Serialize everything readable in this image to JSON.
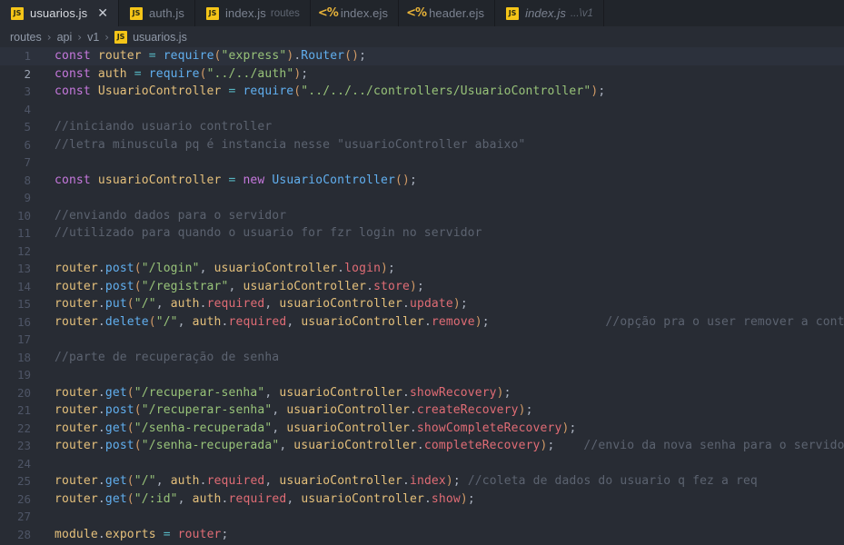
{
  "window": {
    "active_file": "usuarios.js",
    "theme_background": "#282c34",
    "accent": "#61afef"
  },
  "tabs": [
    {
      "label": "usuarios.js",
      "desc": "",
      "icon": "js-file-icon",
      "active": true,
      "preview": false,
      "closable": true
    },
    {
      "label": "auth.js",
      "desc": "",
      "icon": "js-file-icon",
      "active": false,
      "preview": false,
      "closable": false
    },
    {
      "label": "index.js",
      "desc": "routes",
      "icon": "js-file-icon",
      "active": false,
      "preview": false,
      "closable": false
    },
    {
      "label": "index.ejs",
      "desc": "",
      "icon": "ejs-file-icon",
      "active": false,
      "preview": false,
      "closable": false
    },
    {
      "label": "header.ejs",
      "desc": "",
      "icon": "ejs-file-icon",
      "active": false,
      "preview": false,
      "closable": false
    },
    {
      "label": "index.js",
      "desc": "...\\v1",
      "icon": "js-file-icon",
      "active": false,
      "preview": true,
      "closable": false
    }
  ],
  "tab_close_glyph": "✕",
  "breadcrumb": {
    "separator": "›",
    "items": [
      "routes",
      "api",
      "v1"
    ],
    "file": "usuarios.js",
    "file_icon": "js-file-icon"
  },
  "editor": {
    "language": "javascript",
    "first_line": 1,
    "cursor_line": 2,
    "highlighted_lines": [
      1
    ],
    "lines": [
      {
        "n": 1,
        "tokens": [
          {
            "t": "const",
            "c": "kw"
          },
          {
            "t": " "
          },
          {
            "t": "router",
            "c": "var"
          },
          {
            "t": " "
          },
          {
            "t": "=",
            "c": "op"
          },
          {
            "t": " "
          },
          {
            "t": "require",
            "c": "fn"
          },
          {
            "t": "(",
            "c": "par"
          },
          {
            "t": "\"express\"",
            "c": "str"
          },
          {
            "t": ")",
            "c": "par"
          },
          {
            "t": ".",
            "c": "pun"
          },
          {
            "t": "Router",
            "c": "fn"
          },
          {
            "t": "(",
            "c": "par"
          },
          {
            "t": ")",
            "c": "par"
          },
          {
            "t": ";",
            "c": "pun"
          }
        ]
      },
      {
        "n": 2,
        "tokens": [
          {
            "t": "const",
            "c": "kw"
          },
          {
            "t": " "
          },
          {
            "t": "auth",
            "c": "var"
          },
          {
            "t": " "
          },
          {
            "t": "=",
            "c": "op"
          },
          {
            "t": " "
          },
          {
            "t": "require",
            "c": "fn"
          },
          {
            "t": "(",
            "c": "par"
          },
          {
            "t": "\"../../auth\"",
            "c": "str"
          },
          {
            "t": ")",
            "c": "par"
          },
          {
            "t": ";",
            "c": "pun"
          }
        ]
      },
      {
        "n": 3,
        "tokens": [
          {
            "t": "const",
            "c": "kw"
          },
          {
            "t": " "
          },
          {
            "t": "UsuarioController",
            "c": "var"
          },
          {
            "t": " "
          },
          {
            "t": "=",
            "c": "op"
          },
          {
            "t": " "
          },
          {
            "t": "require",
            "c": "fn"
          },
          {
            "t": "(",
            "c": "par"
          },
          {
            "t": "\"../../../controllers/UsuarioController\"",
            "c": "str"
          },
          {
            "t": ")",
            "c": "par"
          },
          {
            "t": ";",
            "c": "pun"
          }
        ]
      },
      {
        "n": 4,
        "tokens": []
      },
      {
        "n": 5,
        "tokens": [
          {
            "t": "//iniciando usuario controller",
            "c": "cmt"
          }
        ]
      },
      {
        "n": 6,
        "tokens": [
          {
            "t": "//letra minuscula pq é instancia nesse \"usuarioController abaixo\"",
            "c": "cmt"
          }
        ]
      },
      {
        "n": 7,
        "tokens": []
      },
      {
        "n": 8,
        "tokens": [
          {
            "t": "const",
            "c": "kw"
          },
          {
            "t": " "
          },
          {
            "t": "usuarioController",
            "c": "var"
          },
          {
            "t": " "
          },
          {
            "t": "=",
            "c": "op"
          },
          {
            "t": " "
          },
          {
            "t": "new",
            "c": "kw"
          },
          {
            "t": " "
          },
          {
            "t": "UsuarioController",
            "c": "fn"
          },
          {
            "t": "(",
            "c": "par"
          },
          {
            "t": ")",
            "c": "par"
          },
          {
            "t": ";",
            "c": "pun"
          }
        ]
      },
      {
        "n": 9,
        "tokens": []
      },
      {
        "n": 10,
        "tokens": [
          {
            "t": "//enviando dados para o servidor",
            "c": "cmt"
          }
        ]
      },
      {
        "n": 11,
        "tokens": [
          {
            "t": "//utilizado para quando o usuario for fzr login no servidor",
            "c": "cmt"
          }
        ]
      },
      {
        "n": 12,
        "tokens": []
      },
      {
        "n": 13,
        "tokens": [
          {
            "t": "router",
            "c": "var"
          },
          {
            "t": ".",
            "c": "pun"
          },
          {
            "t": "post",
            "c": "fn"
          },
          {
            "t": "(",
            "c": "par"
          },
          {
            "t": "\"/login\"",
            "c": "str"
          },
          {
            "t": ", ",
            "c": "pun"
          },
          {
            "t": "usuarioController",
            "c": "var"
          },
          {
            "t": ".",
            "c": "pun"
          },
          {
            "t": "login",
            "c": "prop"
          },
          {
            "t": ")",
            "c": "par"
          },
          {
            "t": ";",
            "c": "pun"
          }
        ]
      },
      {
        "n": 14,
        "tokens": [
          {
            "t": "router",
            "c": "var"
          },
          {
            "t": ".",
            "c": "pun"
          },
          {
            "t": "post",
            "c": "fn"
          },
          {
            "t": "(",
            "c": "par"
          },
          {
            "t": "\"/registrar\"",
            "c": "str"
          },
          {
            "t": ", ",
            "c": "pun"
          },
          {
            "t": "usuarioController",
            "c": "var"
          },
          {
            "t": ".",
            "c": "pun"
          },
          {
            "t": "store",
            "c": "prop"
          },
          {
            "t": ")",
            "c": "par"
          },
          {
            "t": ";",
            "c": "pun"
          }
        ]
      },
      {
        "n": 15,
        "tokens": [
          {
            "t": "router",
            "c": "var"
          },
          {
            "t": ".",
            "c": "pun"
          },
          {
            "t": "put",
            "c": "fn"
          },
          {
            "t": "(",
            "c": "par"
          },
          {
            "t": "\"/\"",
            "c": "str"
          },
          {
            "t": ", ",
            "c": "pun"
          },
          {
            "t": "auth",
            "c": "var"
          },
          {
            "t": ".",
            "c": "pun"
          },
          {
            "t": "required",
            "c": "prop"
          },
          {
            "t": ", ",
            "c": "pun"
          },
          {
            "t": "usuarioController",
            "c": "var"
          },
          {
            "t": ".",
            "c": "pun"
          },
          {
            "t": "update",
            "c": "prop"
          },
          {
            "t": ")",
            "c": "par"
          },
          {
            "t": ";",
            "c": "pun"
          }
        ]
      },
      {
        "n": 16,
        "tokens": [
          {
            "t": "router",
            "c": "var"
          },
          {
            "t": ".",
            "c": "pun"
          },
          {
            "t": "delete",
            "c": "fn"
          },
          {
            "t": "(",
            "c": "par"
          },
          {
            "t": "\"/\"",
            "c": "str"
          },
          {
            "t": ", ",
            "c": "pun"
          },
          {
            "t": "auth",
            "c": "var"
          },
          {
            "t": ".",
            "c": "pun"
          },
          {
            "t": "required",
            "c": "prop"
          },
          {
            "t": ", ",
            "c": "pun"
          },
          {
            "t": "usuarioController",
            "c": "var"
          },
          {
            "t": ".",
            "c": "pun"
          },
          {
            "t": "remove",
            "c": "prop"
          },
          {
            "t": ")",
            "c": "par"
          },
          {
            "t": ";",
            "c": "pun"
          },
          {
            "t": "                ",
            "c": "pun"
          },
          {
            "t": "//opção pra o user remover a conta",
            "c": "cmt"
          }
        ]
      },
      {
        "n": 17,
        "tokens": []
      },
      {
        "n": 18,
        "tokens": [
          {
            "t": "//parte de recuperação de senha",
            "c": "cmt"
          }
        ]
      },
      {
        "n": 19,
        "tokens": []
      },
      {
        "n": 20,
        "tokens": [
          {
            "t": "router",
            "c": "var"
          },
          {
            "t": ".",
            "c": "pun"
          },
          {
            "t": "get",
            "c": "fn"
          },
          {
            "t": "(",
            "c": "par"
          },
          {
            "t": "\"/recuperar-senha\"",
            "c": "str"
          },
          {
            "t": ", ",
            "c": "pun"
          },
          {
            "t": "usuarioController",
            "c": "var"
          },
          {
            "t": ".",
            "c": "pun"
          },
          {
            "t": "showRecovery",
            "c": "prop"
          },
          {
            "t": ")",
            "c": "par"
          },
          {
            "t": ";",
            "c": "pun"
          }
        ]
      },
      {
        "n": 21,
        "tokens": [
          {
            "t": "router",
            "c": "var"
          },
          {
            "t": ".",
            "c": "pun"
          },
          {
            "t": "post",
            "c": "fn"
          },
          {
            "t": "(",
            "c": "par"
          },
          {
            "t": "\"/recuperar-senha\"",
            "c": "str"
          },
          {
            "t": ", ",
            "c": "pun"
          },
          {
            "t": "usuarioController",
            "c": "var"
          },
          {
            "t": ".",
            "c": "pun"
          },
          {
            "t": "createRecovery",
            "c": "prop"
          },
          {
            "t": ")",
            "c": "par"
          },
          {
            "t": ";",
            "c": "pun"
          }
        ]
      },
      {
        "n": 22,
        "tokens": [
          {
            "t": "router",
            "c": "var"
          },
          {
            "t": ".",
            "c": "pun"
          },
          {
            "t": "get",
            "c": "fn"
          },
          {
            "t": "(",
            "c": "par"
          },
          {
            "t": "\"/senha-recuperada\"",
            "c": "str"
          },
          {
            "t": ", ",
            "c": "pun"
          },
          {
            "t": "usuarioController",
            "c": "var"
          },
          {
            "t": ".",
            "c": "pun"
          },
          {
            "t": "showCompleteRecovery",
            "c": "prop"
          },
          {
            "t": ")",
            "c": "par"
          },
          {
            "t": ";",
            "c": "pun"
          }
        ]
      },
      {
        "n": 23,
        "tokens": [
          {
            "t": "router",
            "c": "var"
          },
          {
            "t": ".",
            "c": "pun"
          },
          {
            "t": "post",
            "c": "fn"
          },
          {
            "t": "(",
            "c": "par"
          },
          {
            "t": "\"/senha-recuperada\"",
            "c": "str"
          },
          {
            "t": ", ",
            "c": "pun"
          },
          {
            "t": "usuarioController",
            "c": "var"
          },
          {
            "t": ".",
            "c": "pun"
          },
          {
            "t": "completeRecovery",
            "c": "prop"
          },
          {
            "t": ")",
            "c": "par"
          },
          {
            "t": ";",
            "c": "pun"
          },
          {
            "t": "    ",
            "c": "pun"
          },
          {
            "t": "//envio da nova senha para o servidor",
            "c": "cmt"
          }
        ]
      },
      {
        "n": 24,
        "tokens": []
      },
      {
        "n": 25,
        "tokens": [
          {
            "t": "router",
            "c": "var"
          },
          {
            "t": ".",
            "c": "pun"
          },
          {
            "t": "get",
            "c": "fn"
          },
          {
            "t": "(",
            "c": "par"
          },
          {
            "t": "\"/\"",
            "c": "str"
          },
          {
            "t": ", ",
            "c": "pun"
          },
          {
            "t": "auth",
            "c": "var"
          },
          {
            "t": ".",
            "c": "pun"
          },
          {
            "t": "required",
            "c": "prop"
          },
          {
            "t": ", ",
            "c": "pun"
          },
          {
            "t": "usuarioController",
            "c": "var"
          },
          {
            "t": ".",
            "c": "pun"
          },
          {
            "t": "index",
            "c": "prop"
          },
          {
            "t": ")",
            "c": "par"
          },
          {
            "t": "; ",
            "c": "pun"
          },
          {
            "t": "//coleta de dados do usuario q fez a req",
            "c": "cmt"
          }
        ]
      },
      {
        "n": 26,
        "tokens": [
          {
            "t": "router",
            "c": "var"
          },
          {
            "t": ".",
            "c": "pun"
          },
          {
            "t": "get",
            "c": "fn"
          },
          {
            "t": "(",
            "c": "par"
          },
          {
            "t": "\"/:id\"",
            "c": "str"
          },
          {
            "t": ", ",
            "c": "pun"
          },
          {
            "t": "auth",
            "c": "var"
          },
          {
            "t": ".",
            "c": "pun"
          },
          {
            "t": "required",
            "c": "prop"
          },
          {
            "t": ", ",
            "c": "pun"
          },
          {
            "t": "usuarioController",
            "c": "var"
          },
          {
            "t": ".",
            "c": "pun"
          },
          {
            "t": "show",
            "c": "prop"
          },
          {
            "t": ")",
            "c": "par"
          },
          {
            "t": ";",
            "c": "pun"
          }
        ]
      },
      {
        "n": 27,
        "tokens": []
      },
      {
        "n": 28,
        "tokens": [
          {
            "t": "module",
            "c": "var"
          },
          {
            "t": ".",
            "c": "pun"
          },
          {
            "t": "exports",
            "c": "var"
          },
          {
            "t": " "
          },
          {
            "t": "=",
            "c": "op"
          },
          {
            "t": " "
          },
          {
            "t": "router",
            "c": "prop"
          },
          {
            "t": ";",
            "c": "pun"
          }
        ]
      }
    ]
  }
}
